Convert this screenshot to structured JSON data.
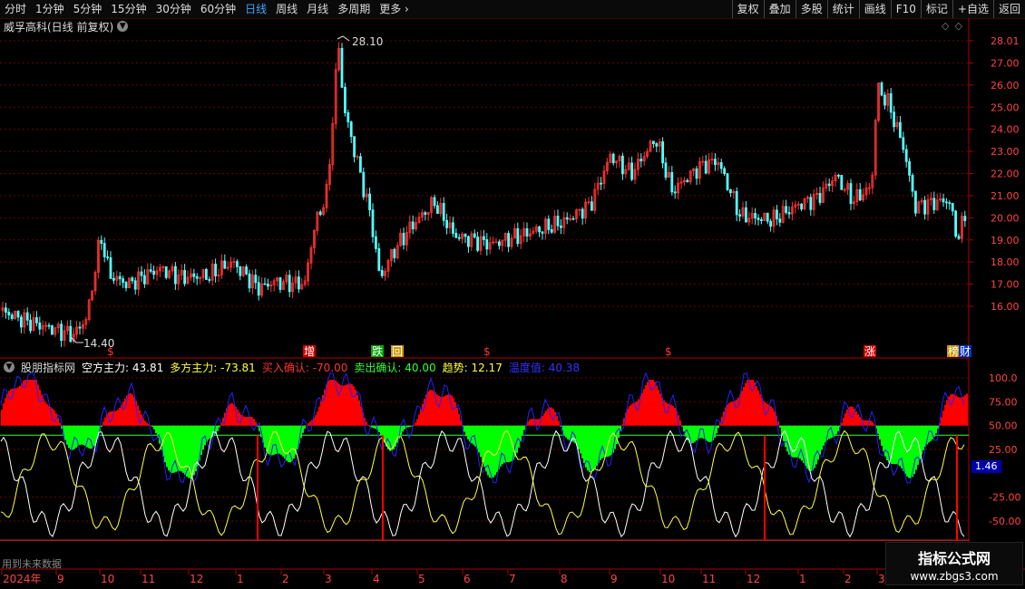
{
  "toolbar": {
    "periods": [
      "分时",
      "1分钟",
      "5分钟",
      "15分钟",
      "30分钟",
      "60分钟",
      "日线",
      "周线",
      "月线",
      "多周期",
      "更多"
    ],
    "active_period": "日线",
    "tools": [
      "复权",
      "叠加",
      "多股",
      "统计",
      "画线",
      "F10",
      "标记",
      "+自选",
      "返回"
    ]
  },
  "title": {
    "stock": "威孚高科(日线 前复权)"
  },
  "price_axis": [
    "28.01",
    "27.00",
    "26.00",
    "25.00",
    "24.00",
    "23.00",
    "22.00",
    "21.00",
    "20.00",
    "19.00",
    "18.00",
    "17.00",
    "16.00"
  ],
  "price_annotations": {
    "high": "28.10",
    "low": "14.40"
  },
  "signal_marks": [
    {
      "text": "$",
      "color": "#ff3333",
      "style": "plain"
    },
    {
      "text": "增",
      "color": "#ffffff",
      "style": "red"
    },
    {
      "text": "跌",
      "color": "#ffffff",
      "style": "green"
    },
    {
      "text": "回",
      "color": "#ffffff",
      "style": "yellow"
    },
    {
      "text": "$",
      "color": "#ff3333",
      "style": "plain"
    },
    {
      "text": "$",
      "color": "#ff3333",
      "style": "plain"
    },
    {
      "text": "涨",
      "color": "#ffffff",
      "style": "red"
    },
    {
      "text": "榜",
      "color": "#ffffff",
      "style": "yellow"
    },
    {
      "text": "财",
      "color": "#ffffff",
      "style": "blue"
    }
  ],
  "indicator": {
    "name": "股朋指标网",
    "fields": [
      {
        "label": "空方主力:",
        "value": "43.81",
        "color": "#ffffff"
      },
      {
        "label": "多方主力:",
        "value": "-73.81",
        "color": "#ffff33"
      },
      {
        "label": "买入确认:",
        "value": "-70.00",
        "color": "#ff3333"
      },
      {
        "label": "卖出确认:",
        "value": "40.00",
        "color": "#33ff33"
      },
      {
        "label": "趋势:",
        "value": "12.17",
        "color": "#ffff33"
      },
      {
        "label": "温度值:",
        "value": "40.38",
        "color": "#3333ff"
      }
    ],
    "axis": [
      "100.0",
      "75.00",
      "50.00",
      "25.00",
      "-25.00",
      "-50.00"
    ],
    "current_tag": "1.46"
  },
  "future_note": "用到未来数据",
  "time_axis": [
    "2024年",
    "9",
    "10",
    "11",
    "12",
    "1",
    "2",
    "3",
    "4",
    "5",
    "6",
    "7",
    "8",
    "9",
    "10",
    "11",
    "12",
    "1",
    "2",
    "3"
  ],
  "watermark": {
    "line1": "指标公式网",
    "line2": "www.zbgs3.com"
  },
  "colors": {
    "up": "#ff3333",
    "down": "#54ffff",
    "accent": "#3fa7ff"
  }
}
